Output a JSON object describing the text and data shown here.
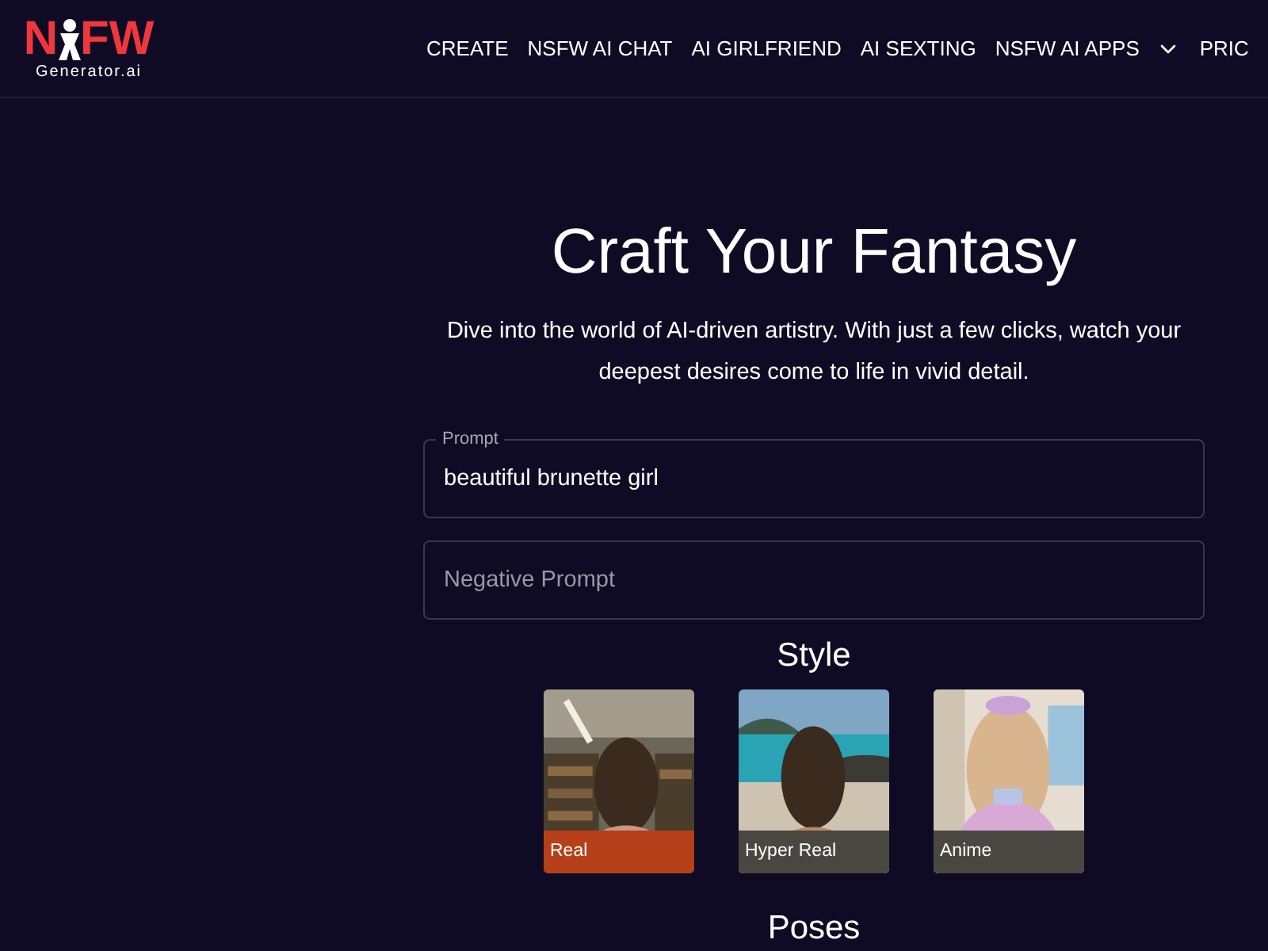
{
  "header": {
    "logo": {
      "left": "N",
      "right": "FW",
      "subtitle": "Generator.ai"
    },
    "nav": [
      {
        "label": "CREATE",
        "dropdown": false
      },
      {
        "label": "NSFW AI CHAT",
        "dropdown": false
      },
      {
        "label": "AI GIRLFRIEND",
        "dropdown": false
      },
      {
        "label": "AI SEXTING",
        "dropdown": false
      },
      {
        "label": "NSFW AI APPS",
        "dropdown": true
      },
      {
        "label": "PRIC",
        "dropdown": false
      }
    ]
  },
  "hero": {
    "title": "Craft Your Fantasy",
    "description": "Dive into the world of AI-driven artistry. With just a few clicks, watch your deepest desires come to life in vivid detail."
  },
  "prompt": {
    "label": "Prompt",
    "value": "beautiful brunette girl"
  },
  "negative_prompt": {
    "placeholder": "Negative Prompt"
  },
  "style": {
    "title": "Style",
    "options": [
      {
        "label": "Real",
        "selected": true,
        "kind": "picture"
      },
      {
        "label": "Hyper Real",
        "selected": false,
        "kind": "picture"
      },
      {
        "label": "Anime",
        "selected": false,
        "kind": "picture"
      }
    ]
  },
  "poses": {
    "title": "Poses"
  }
}
